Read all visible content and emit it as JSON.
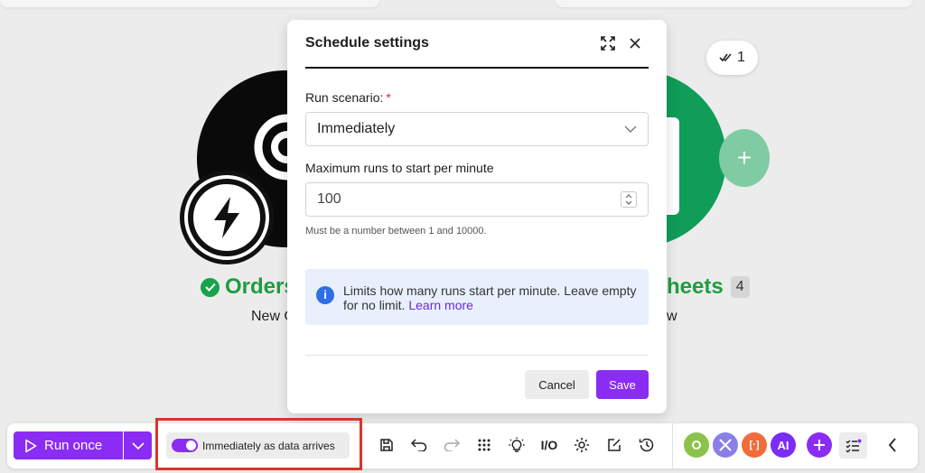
{
  "canvas": {
    "left_module": {
      "name": "Orders",
      "subtitle": "New O"
    },
    "right_module": {
      "name": "heets",
      "subtitle": "w",
      "count": "4"
    },
    "check_badge": {
      "icon": "double-check-icon",
      "count": "1"
    },
    "add_module": {
      "icon": "plus-icon"
    },
    "colors": {
      "success_green": "#1f9d3f",
      "sheets_green": "#0f9d58"
    }
  },
  "dialog": {
    "title": "Schedule settings",
    "run_scenario": {
      "label": "Run scenario:",
      "required_mark": "*",
      "value": "Immediately"
    },
    "max_runs": {
      "label": "Maximum runs to start per minute",
      "value": "100",
      "help": "Must be a number between 1 and 10000."
    },
    "info": {
      "text": "Limits how many runs start per minute. Leave empty for no limit.",
      "link": "Learn more"
    },
    "cancel_label": "Cancel",
    "save_label": "Save"
  },
  "toolbar": {
    "run_once_label": "Run once",
    "schedule_label": "Immediately as data arrives",
    "schedule_enabled": true,
    "tools": [
      "save-icon",
      "undo-icon",
      "redo-icon",
      "grid-icon",
      "lightbulb-icon",
      "io-icon",
      "settings-gear-icon",
      "notes-icon",
      "history-icon"
    ],
    "io_label": "I/O",
    "ai_label": "AI",
    "colors": {
      "accent": "#8b2cf5",
      "highlight_border": "#d9352b"
    }
  }
}
